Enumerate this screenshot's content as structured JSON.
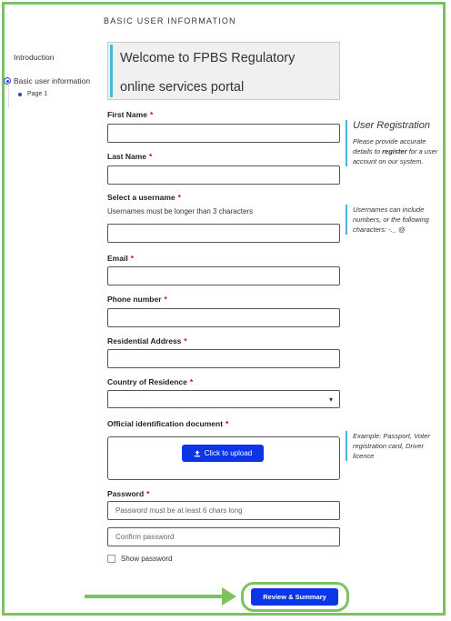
{
  "section_title": "BASIC USER INFORMATION",
  "sidebar": {
    "items": [
      {
        "label": "Introduction"
      },
      {
        "label": "Basic user information"
      },
      {
        "label": "Page 1"
      }
    ]
  },
  "welcome": {
    "line1": "Welcome to FPBS Regulatory",
    "line2": "online services portal"
  },
  "form": {
    "first_name": {
      "label": "First Name",
      "value": ""
    },
    "last_name": {
      "label": "Last Name",
      "value": ""
    },
    "username": {
      "label": "Select a username",
      "hint": "Usernames must be longer than 3 characters",
      "value": ""
    },
    "email": {
      "label": "Email",
      "value": ""
    },
    "phone": {
      "label": "Phone number",
      "value": ""
    },
    "address": {
      "label": "Residential Address",
      "value": ""
    },
    "country": {
      "label": "Country of Residence",
      "selected": ""
    },
    "id_document": {
      "label": "Official identification document",
      "upload_label": "Click to upload"
    },
    "password": {
      "label": "Password",
      "placeholder": "Password must be at least 6 chars long"
    },
    "confirm_password": {
      "placeholder": "Confirm password"
    },
    "show_password_label": "Show password",
    "required_mark": "*"
  },
  "help": {
    "title": "User Registration",
    "registration_pre": "Please provide accurate details to ",
    "registration_bold": "register",
    "registration_post": " for a user account on our system.",
    "username_text": "Usernames can include numbers, or the following characters: -._ @",
    "document_text": "Example: Passport, Voter registration card, Driver licence"
  },
  "review_button": "Review & Summary",
  "colors": {
    "accent": "#0b36e8",
    "highlight": "#7cc35f",
    "required": "#d0021b",
    "info_bar": "#4bb4d8"
  },
  "icons": {
    "upload": "upload-icon",
    "chevron": "chevron-down-icon",
    "arrow": "arrow-right-icon"
  }
}
